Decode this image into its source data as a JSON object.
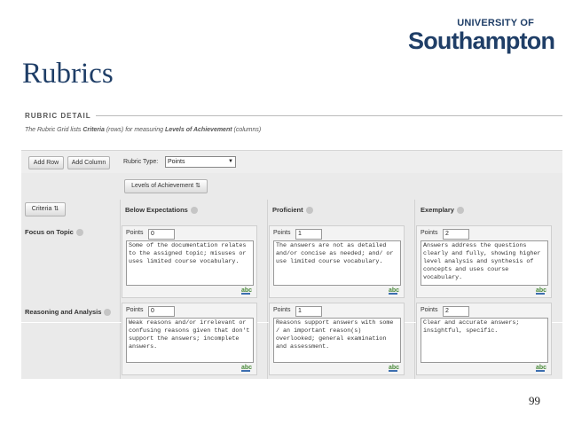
{
  "logo": {
    "line1": "UNIVERSITY OF",
    "line2": "Southampton"
  },
  "slide_title": "Rubrics",
  "page_number": "99",
  "rubric": {
    "section_heading": "RUBRIC DETAIL",
    "description": {
      "prefix": "The Rubric Grid lists ",
      "criteria_word": "Criteria",
      "middle": " (rows) for measuring ",
      "levels_word": "Levels of Achievement",
      "suffix": " (columns)"
    },
    "toolbar": {
      "add_row": "Add Row",
      "add_column": "Add Column",
      "rubric_type_label": "Rubric Type:",
      "rubric_type_value": "Points"
    },
    "levels_button": "Levels of Achievement",
    "criteria_button": "Criteria",
    "columns": [
      {
        "label": "Below Expectations"
      },
      {
        "label": "Proficient"
      },
      {
        "label": "Exemplary"
      }
    ],
    "points_label": "Points",
    "rows": [
      {
        "label": "Focus on Topic",
        "cells": [
          {
            "points": "0",
            "text": "Some of the documentation relates to the assigned topic; misuses or uses limited course vocabulary."
          },
          {
            "points": "1",
            "text": "The answers are not as detailed and/or concise as needed; and/ or use limited course vocabulary."
          },
          {
            "points": "2",
            "text": "Answers address the questions clearly and fully, showing higher level analysis and synthesis of concepts and uses course vocabulary."
          }
        ]
      },
      {
        "label": "Reasoning and Analysis",
        "cells": [
          {
            "points": "0",
            "text": "Weak reasons and/or irrelevant or confusing reasons given that don't support the answers; incomplete answers."
          },
          {
            "points": "1",
            "text": "Reasons support answers with some / an important reason(s) overlooked; general examination and assessment."
          },
          {
            "points": "2",
            "text": "Clear and accurate answers; insightful, specific."
          }
        ]
      }
    ],
    "spellcheck_label": "abc"
  }
}
